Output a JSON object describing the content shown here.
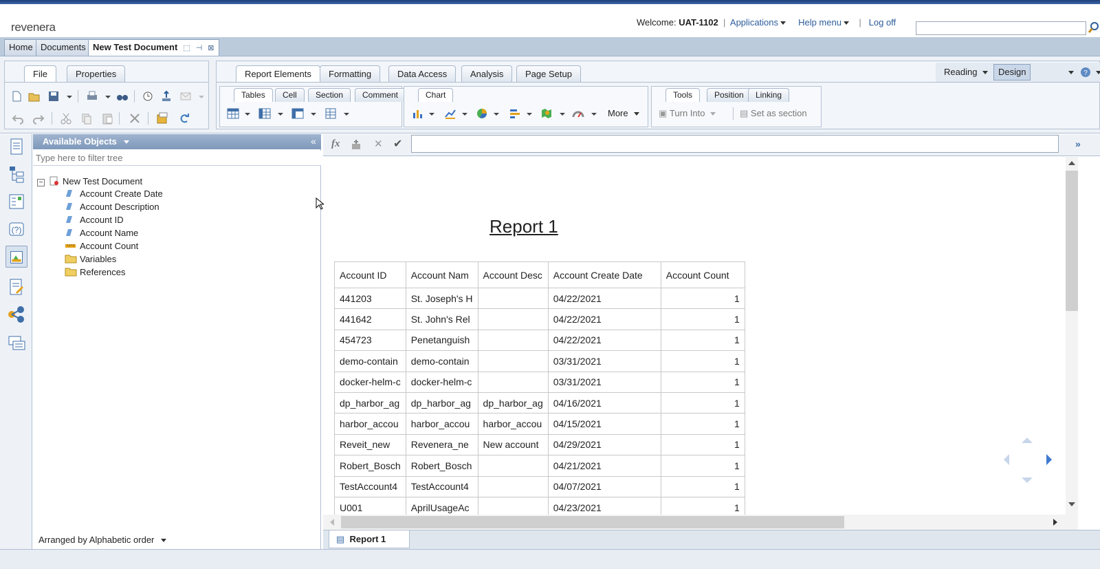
{
  "header": {
    "logo": "revenera",
    "welcome_prefix": "Welcome:",
    "user": "UAT-1102",
    "applications": "Applications",
    "help_menu": "Help menu",
    "log_off": "Log off",
    "search_value": ""
  },
  "doc_tabs": [
    "Home",
    "Documents",
    "New Test Document"
  ],
  "left_tabs": [
    "File",
    "Properties"
  ],
  "main_tabs": [
    "Report Elements",
    "Formatting",
    "Data Access",
    "Analysis",
    "Page Setup"
  ],
  "view_modes": [
    "Reading",
    "Design"
  ],
  "sub_tabs": {
    "table_group": [
      "Tables",
      "Cell",
      "Section",
      "Comment"
    ],
    "chart_group": [
      "Chart"
    ],
    "tools_group": [
      "Tools",
      "Position",
      "Linking"
    ]
  },
  "toolbar": {
    "more": "More",
    "turn_into": "Turn Into",
    "set_as_section": "Set as section"
  },
  "objects_panel": {
    "title": "Available Objects",
    "filter_placeholder": "Type here to filter tree",
    "root": "New Test Document",
    "items": [
      {
        "label": "Account Create Date",
        "kind": "dimension"
      },
      {
        "label": "Account Description",
        "kind": "dimension"
      },
      {
        "label": "Account ID",
        "kind": "dimension"
      },
      {
        "label": "Account Name",
        "kind": "dimension"
      },
      {
        "label": "Account Count",
        "kind": "measure"
      },
      {
        "label": "Variables",
        "kind": "folder"
      },
      {
        "label": "References",
        "kind": "folder"
      }
    ],
    "footer": "Arranged by Alphabetic order"
  },
  "report": {
    "title": "Report 1",
    "columns": [
      "Account ID",
      "Account Nam",
      "Account Desc",
      "Account Create Date",
      "Account Count"
    ],
    "rows": [
      [
        "441203",
        "St. Joseph's H",
        "",
        "04/22/2021",
        "1"
      ],
      [
        "441642",
        "St. John's Rel",
        "",
        "04/22/2021",
        "1"
      ],
      [
        "454723",
        "Penetanguish",
        "",
        "04/22/2021",
        "1"
      ],
      [
        "demo-contain",
        "demo-contain",
        "",
        "03/31/2021",
        "1"
      ],
      [
        "docker-helm-c",
        "docker-helm-c",
        "",
        "03/31/2021",
        "1"
      ],
      [
        "dp_harbor_ag",
        "dp_harbor_ag",
        "dp_harbor_ag",
        "04/16/2021",
        "1"
      ],
      [
        "harbor_accou",
        "harbor_accou",
        "harbor_accou",
        "04/15/2021",
        "1"
      ],
      [
        "Reveit_new",
        "Revenera_ne",
        "New account",
        "04/29/2021",
        "1"
      ],
      [
        "Robert_Bosch",
        "Robert_Bosch",
        "",
        "04/21/2021",
        "1"
      ],
      [
        "TestAccount4",
        "TestAccount4",
        "",
        "04/07/2021",
        "1"
      ],
      [
        "U001",
        "AprilUsageAc",
        "",
        "04/23/2021",
        "1"
      ]
    ],
    "sheet_tab": "Report 1"
  },
  "colors": {
    "accent": "#2c5d9b",
    "panel_header": "#8aa3c3",
    "chrome": "#eef2f7"
  }
}
